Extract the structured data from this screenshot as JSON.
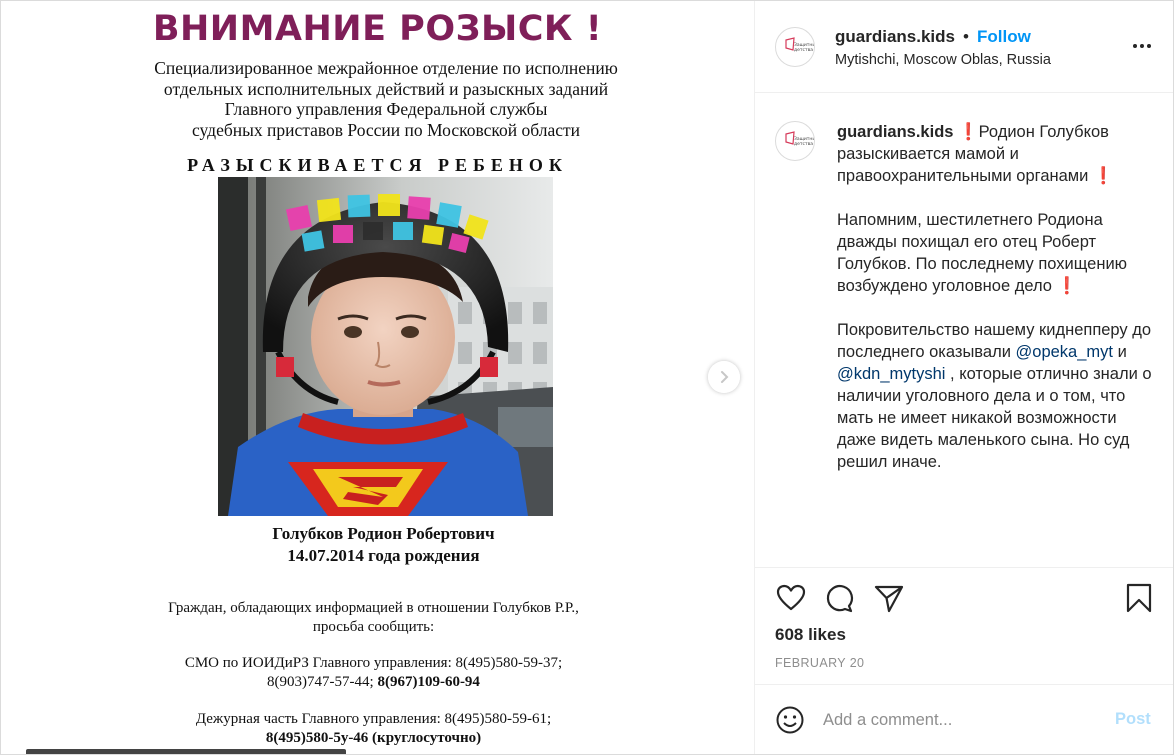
{
  "poster": {
    "title": "ВНИМАНИЕ РОЗЫСК !",
    "org_lines": [
      "Специализированное межрайонное отделение по исполнению",
      "отдельных исполнительных действий и разыскных заданий",
      "Главного управления Федеральной службы",
      "судебных приставов России по Московской области"
    ],
    "wanted": "РАЗЫСКИВАЕТСЯ РЕБЕНОК",
    "child_name": "Голубков Родион Робертович",
    "child_birth": "14.07.2014 года рождения",
    "info1_line1": "Граждан, обладающих информацией в отношении Голубков Р.Р.,",
    "info1_line2": "просьба сообщить:",
    "info2_line1": "СМО по ИОИДиРЗ Главного управления: 8(495)580-59-37;",
    "info2_line2a": "8(903)747-57-44; ",
    "info2_line2b": "8(967)109-60-94",
    "info3_line1": "Дежурная часть Главного управления: 8(495)580-59-61;",
    "info3_line2": "8(495)580-5у-46 (круглосуточно)"
  },
  "header": {
    "username": "guardians.kids",
    "dot": "•",
    "follow_label": "Follow",
    "location": "Mytishchi, Moscow Oblas, Russia"
  },
  "caption": {
    "username": "guardians.kids",
    "p1": "Родион Голубков разыскивается мамой и правоохранительными органами",
    "p2": "Напомним, шестилетнего Родиона дважды похищал его отец Роберт Голубков. По последнему похищению возбуждено уголовное дело",
    "p3_start": "Покровительство нашему киднепперу до последнего оказывали",
    "mention1": "@opeka_myt",
    "p3_and": "и",
    "mention2": "@kdn_mytyshi",
    "p3_end": ", которые отлично знали о наличии уголовного дела и о том, что мать не имеет никакой возможности даже видеть маленького сына. Но суд решил иначе.",
    "excl": "❗"
  },
  "stats": {
    "likes": "608 likes",
    "date": "FEBRUARY 20"
  },
  "comment": {
    "placeholder": "Add a comment...",
    "post_label": "Post"
  },
  "colors": {
    "poster_title": "#7f1f59",
    "follow": "#0095f6",
    "mention": "#00376b",
    "post_disabled": "#b2dffc"
  },
  "icons": [
    "chevron-right-icon",
    "more-options-icon",
    "heart-icon",
    "comment-icon",
    "share-icon",
    "bookmark-icon",
    "emoji-icon"
  ]
}
